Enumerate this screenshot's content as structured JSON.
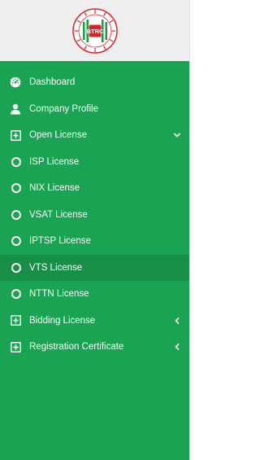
{
  "logo": {
    "text": "BTRC",
    "ring_text_top": "বাংলাদেশ",
    "ring_text_bottom": "টেলিযোগাযোগ নিয়ন্ত্রণ কমিশন"
  },
  "nav": {
    "items": [
      {
        "label": "Dashboard",
        "icon": "dashboard-icon"
      },
      {
        "label": "Company Profile",
        "icon": "user-icon"
      },
      {
        "label": "Open License",
        "icon": "plus-square-icon",
        "expanded": true
      },
      {
        "label": "ISP License",
        "icon": "circle-icon"
      },
      {
        "label": "NIX License",
        "icon": "circle-icon"
      },
      {
        "label": "VSAT License",
        "icon": "circle-icon"
      },
      {
        "label": "IPTSP License",
        "icon": "circle-icon"
      },
      {
        "label": "VTS License",
        "icon": "circle-icon",
        "active": true
      },
      {
        "label": "NTTN License",
        "icon": "circle-icon"
      },
      {
        "label": "Bidding License",
        "icon": "plus-square-icon",
        "expanded": false
      },
      {
        "label": "Registration Certificate",
        "icon": "plus-square-icon",
        "expanded": false
      }
    ]
  },
  "colors": {
    "sidebar_bg": "#1aa352",
    "active_bg": "#178f47",
    "logo_area_bg": "#eeeeee",
    "logo_red": "#d7262b",
    "logo_green": "#1f9a46",
    "text": "#ffffff"
  }
}
